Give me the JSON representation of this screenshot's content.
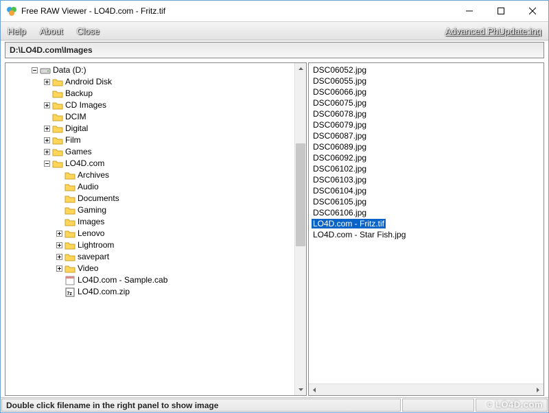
{
  "window": {
    "title": "Free RAW Viewer - LO4D.com - Fritz.tif"
  },
  "menu": {
    "help": "Help",
    "about": "About",
    "close": "Close",
    "advanced": "Advanced PhUpdate:inq"
  },
  "path": "D:\\LO4D.com\\Images",
  "tree": [
    {
      "depth": 0,
      "expander": "minus",
      "icon": "drive",
      "label": "Data (D:)"
    },
    {
      "depth": 1,
      "expander": "plus",
      "icon": "folder",
      "label": "Android Disk"
    },
    {
      "depth": 1,
      "expander": "none",
      "icon": "folder",
      "label": "Backup"
    },
    {
      "depth": 1,
      "expander": "plus",
      "icon": "folder",
      "label": "CD Images"
    },
    {
      "depth": 1,
      "expander": "none",
      "icon": "folder",
      "label": "DCIM"
    },
    {
      "depth": 1,
      "expander": "plus",
      "icon": "folder",
      "label": "Digital"
    },
    {
      "depth": 1,
      "expander": "plus",
      "icon": "folder",
      "label": "Film"
    },
    {
      "depth": 1,
      "expander": "plus",
      "icon": "folder",
      "label": "Games"
    },
    {
      "depth": 1,
      "expander": "minus",
      "icon": "folder",
      "label": "LO4D.com"
    },
    {
      "depth": 2,
      "expander": "none",
      "icon": "folder",
      "label": "Archives"
    },
    {
      "depth": 2,
      "expander": "none",
      "icon": "folder",
      "label": "Audio"
    },
    {
      "depth": 2,
      "expander": "none",
      "icon": "folder",
      "label": "Documents"
    },
    {
      "depth": 2,
      "expander": "none",
      "icon": "folder",
      "label": "Gaming"
    },
    {
      "depth": 2,
      "expander": "none",
      "icon": "folder",
      "label": "Images"
    },
    {
      "depth": 2,
      "expander": "plus",
      "icon": "folder",
      "label": "Lenovo"
    },
    {
      "depth": 2,
      "expander": "plus",
      "icon": "folder",
      "label": "Lightroom"
    },
    {
      "depth": 2,
      "expander": "plus",
      "icon": "folder",
      "label": "savepart"
    },
    {
      "depth": 2,
      "expander": "plus",
      "icon": "folder",
      "label": "Video"
    },
    {
      "depth": 2,
      "expander": "none",
      "icon": "cab",
      "label": "LO4D.com - Sample.cab"
    },
    {
      "depth": 2,
      "expander": "none",
      "icon": "zip",
      "label": "LO4D.com.zip"
    }
  ],
  "files": [
    {
      "name": "DSC06052.jpg",
      "selected": false
    },
    {
      "name": "DSC06055.jpg",
      "selected": false
    },
    {
      "name": "DSC06066.jpg",
      "selected": false
    },
    {
      "name": "DSC06075.jpg",
      "selected": false
    },
    {
      "name": "DSC06078.jpg",
      "selected": false
    },
    {
      "name": "DSC06079.jpg",
      "selected": false
    },
    {
      "name": "DSC06087.jpg",
      "selected": false
    },
    {
      "name": "DSC06089.jpg",
      "selected": false
    },
    {
      "name": "DSC06092.jpg",
      "selected": false
    },
    {
      "name": "DSC06102.jpg",
      "selected": false
    },
    {
      "name": "DSC06103.jpg",
      "selected": false
    },
    {
      "name": "DSC06104.jpg",
      "selected": false
    },
    {
      "name": "DSC06105.jpg",
      "selected": false
    },
    {
      "name": "DSC06106.jpg",
      "selected": false
    },
    {
      "name": "LO4D.com - Fritz.tif",
      "selected": true
    },
    {
      "name": "LO4D.com - Star Fish.jpg",
      "selected": false
    }
  ],
  "status": "Double click filename in the right panel to show image",
  "watermark": "LO4D.com"
}
